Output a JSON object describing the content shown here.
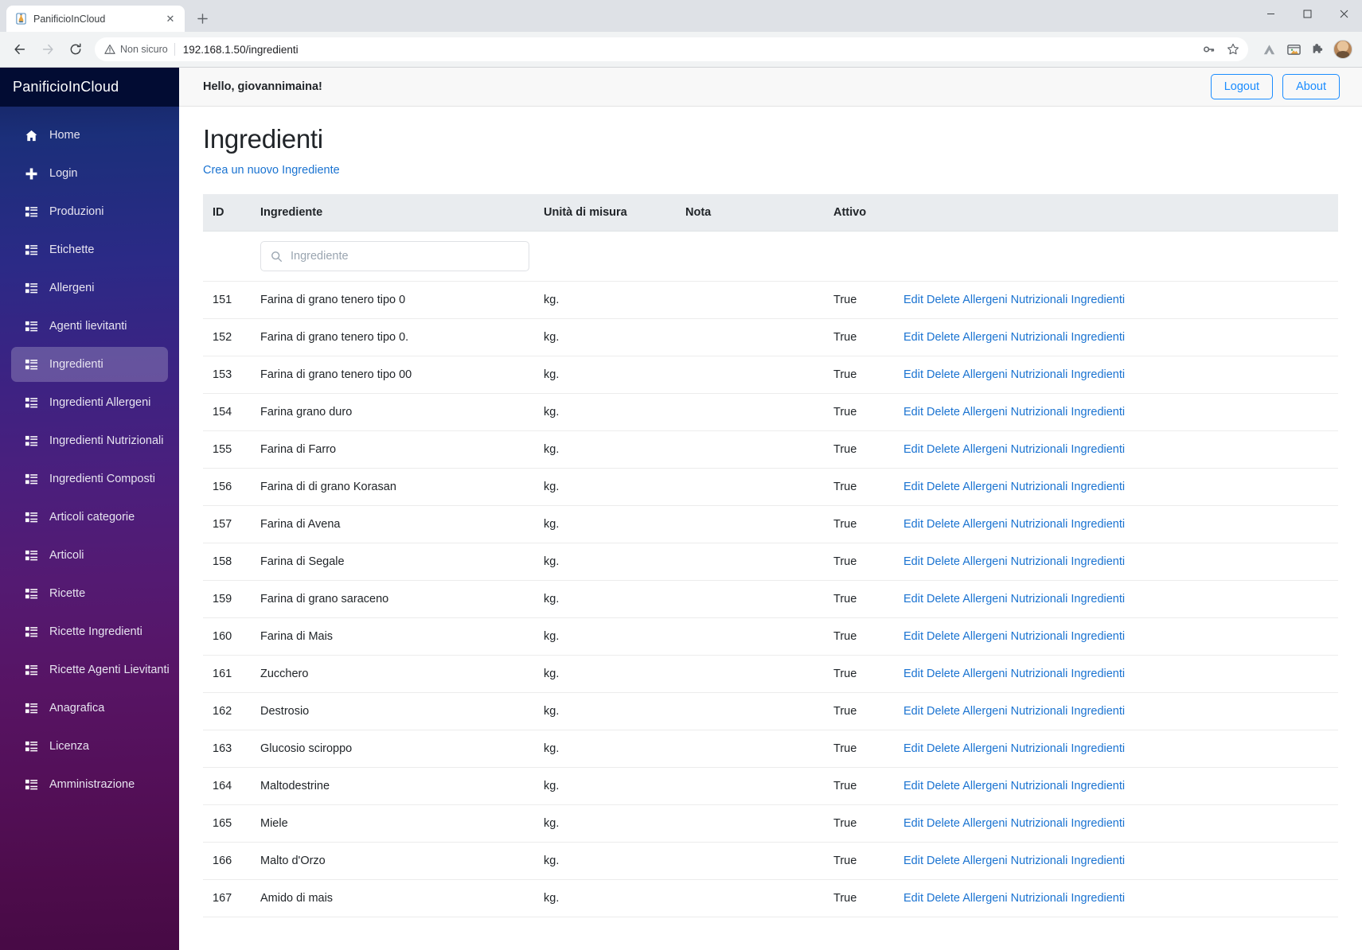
{
  "browser": {
    "tab": {
      "title": "PanificioInCloud",
      "favicon_icon": "bread-favicon",
      "close_icon": "close-icon"
    },
    "new_tab_icon": "plus-icon",
    "window_controls": {
      "minimize": "minimize-icon",
      "maximize": "maximize-icon",
      "close": "close-icon"
    },
    "nav": {
      "back_icon": "arrow-left-icon",
      "forward_icon": "arrow-right-icon",
      "reload_icon": "reload-icon"
    },
    "omnibox": {
      "security_label": "Non sicuro",
      "security_icon": "warning-triangle-icon",
      "url": "192.168.1.50/ingredienti",
      "icons": [
        "key-icon",
        "star-icon"
      ]
    },
    "extensions": [
      "drive-icon",
      "app-window-icon",
      "puzzle-extensions-icon",
      "profile-avatar"
    ]
  },
  "sidebar": {
    "brand": "PanificioInCloud",
    "items": [
      {
        "label": "Home",
        "icon": "home-icon",
        "active": false
      },
      {
        "label": "Login",
        "icon": "plus-icon",
        "active": false
      },
      {
        "label": "Produzioni",
        "icon": "list-icon",
        "active": false
      },
      {
        "label": "Etichette",
        "icon": "list-icon",
        "active": false
      },
      {
        "label": "Allergeni",
        "icon": "list-icon",
        "active": false
      },
      {
        "label": "Agenti lievitanti",
        "icon": "list-icon",
        "active": false
      },
      {
        "label": "Ingredienti",
        "icon": "list-icon",
        "active": true
      },
      {
        "label": "Ingredienti Allergeni",
        "icon": "list-icon",
        "active": false
      },
      {
        "label": "Ingredienti Nutrizionali",
        "icon": "list-icon",
        "active": false
      },
      {
        "label": "Ingredienti Composti",
        "icon": "list-icon",
        "active": false
      },
      {
        "label": "Articoli categorie",
        "icon": "list-icon",
        "active": false
      },
      {
        "label": "Articoli",
        "icon": "list-icon",
        "active": false
      },
      {
        "label": "Ricette",
        "icon": "list-icon",
        "active": false
      },
      {
        "label": "Ricette Ingredienti",
        "icon": "list-icon",
        "active": false
      },
      {
        "label": "Ricette Agenti Lievitanti",
        "icon": "list-icon",
        "active": false
      },
      {
        "label": "Anagrafica",
        "icon": "list-icon",
        "active": false
      },
      {
        "label": "Licenza",
        "icon": "list-icon",
        "active": false
      },
      {
        "label": "Amministrazione",
        "icon": "list-icon",
        "active": false
      }
    ]
  },
  "topbar": {
    "greeting": "Hello, giovannimaina!",
    "logout_label": "Logout",
    "about_label": "About"
  },
  "page": {
    "title": "Ingredienti",
    "create_link": "Crea un nuovo Ingrediente"
  },
  "table": {
    "headers": [
      "ID",
      "Ingrediente",
      "Unità di misura",
      "Nota",
      "Attivo",
      ""
    ],
    "filter": {
      "placeholder": "Ingrediente",
      "value": "",
      "icon": "search-icon"
    },
    "action_links": [
      "Edit",
      "Delete",
      "Allergeni",
      "Nutrizionali",
      "Ingredienti"
    ],
    "rows": [
      {
        "id": "151",
        "ingrediente": "Farina di grano tenero tipo 0",
        "unita": "kg.",
        "nota": "",
        "attivo": "True"
      },
      {
        "id": "152",
        "ingrediente": "Farina di grano tenero tipo 0.",
        "unita": "kg.",
        "nota": "",
        "attivo": "True"
      },
      {
        "id": "153",
        "ingrediente": "Farina di grano tenero tipo 00",
        "unita": "kg.",
        "nota": "",
        "attivo": "True"
      },
      {
        "id": "154",
        "ingrediente": "Farina grano duro",
        "unita": "kg.",
        "nota": "",
        "attivo": "True"
      },
      {
        "id": "155",
        "ingrediente": "Farina di Farro",
        "unita": "kg.",
        "nota": "",
        "attivo": "True"
      },
      {
        "id": "156",
        "ingrediente": "Farina di di grano Korasan",
        "unita": "kg.",
        "nota": "",
        "attivo": "True"
      },
      {
        "id": "157",
        "ingrediente": "Farina di Avena",
        "unita": "kg.",
        "nota": "",
        "attivo": "True"
      },
      {
        "id": "158",
        "ingrediente": "Farina di Segale",
        "unita": "kg.",
        "nota": "",
        "attivo": "True"
      },
      {
        "id": "159",
        "ingrediente": "Farina di grano saraceno",
        "unita": "kg.",
        "nota": "",
        "attivo": "True"
      },
      {
        "id": "160",
        "ingrediente": "Farina di Mais",
        "unita": "kg.",
        "nota": "",
        "attivo": "True"
      },
      {
        "id": "161",
        "ingrediente": "Zucchero",
        "unita": "kg.",
        "nota": "",
        "attivo": "True"
      },
      {
        "id": "162",
        "ingrediente": "Destrosio",
        "unita": "kg.",
        "nota": "",
        "attivo": "True"
      },
      {
        "id": "163",
        "ingrediente": "Glucosio sciroppo",
        "unita": "kg.",
        "nota": "",
        "attivo": "True"
      },
      {
        "id": "164",
        "ingrediente": "Maltodestrine",
        "unita": "kg.",
        "nota": "",
        "attivo": "True"
      },
      {
        "id": "165",
        "ingrediente": "Miele",
        "unita": "kg.",
        "nota": "",
        "attivo": "True"
      },
      {
        "id": "166",
        "ingrediente": "Malto d'Orzo",
        "unita": "kg.",
        "nota": "",
        "attivo": "True"
      },
      {
        "id": "167",
        "ingrediente": "Amido di mais",
        "unita": "kg.",
        "nota": "",
        "attivo": "True"
      }
    ]
  },
  "colors": {
    "link": "#1a73d1",
    "accent_button": "#1a8cff",
    "sidebar_top": "#14225c",
    "sidebar_bottom": "#470a45",
    "brand_bar": "#020c33",
    "table_header_bg": "#e9ecef"
  }
}
